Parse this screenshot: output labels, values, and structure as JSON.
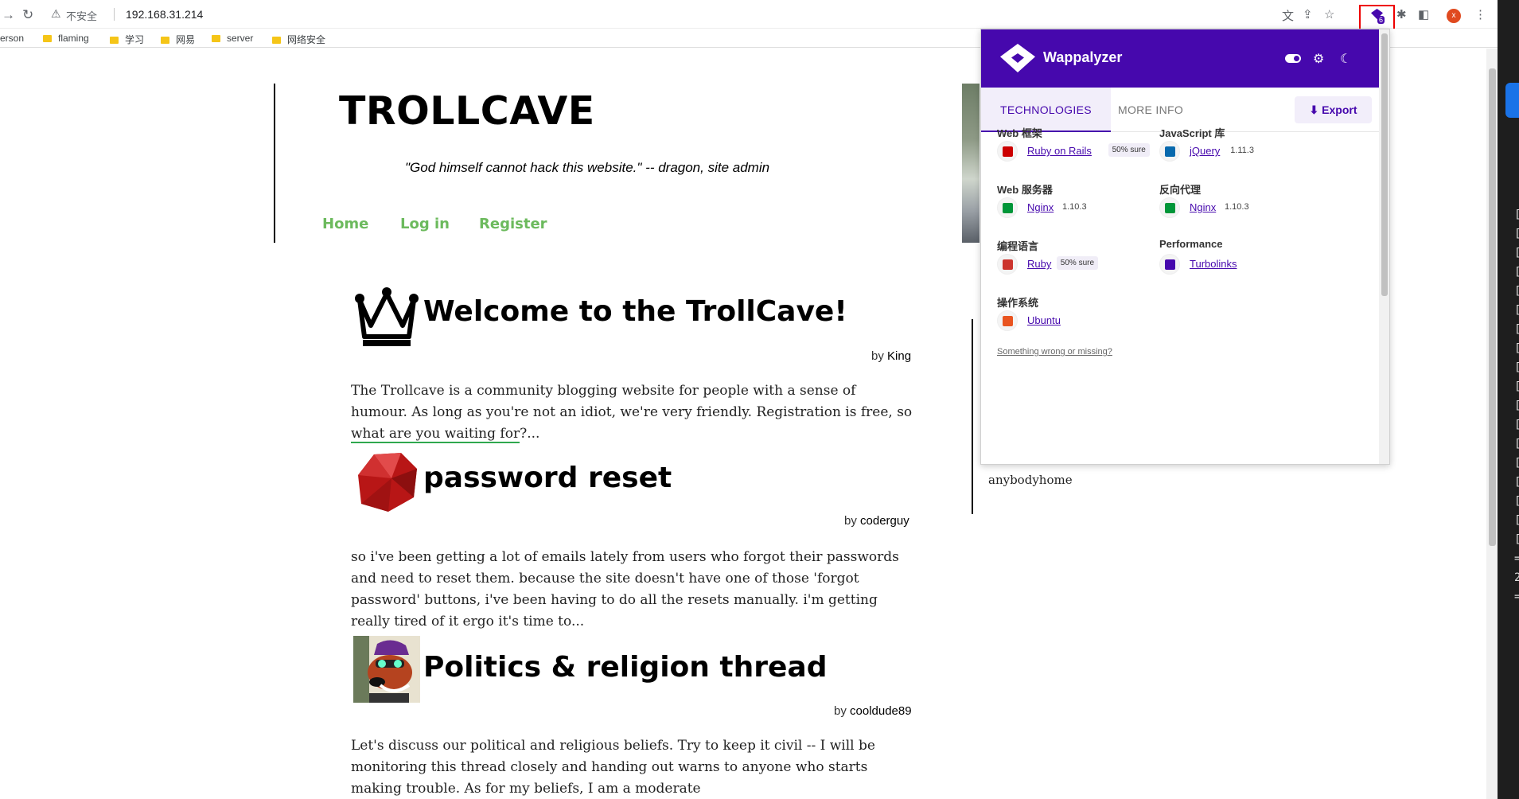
{
  "browser": {
    "back_icon": "arrow-right-icon",
    "url_warning": "不安全",
    "url": "192.168.31.214",
    "avatar_letter": "x",
    "extension_badge": "6"
  },
  "bookmarks": [
    {
      "label": "erson",
      "folder": false
    },
    {
      "label": "flaming",
      "folder": true
    },
    {
      "label": "学习",
      "folder": true
    },
    {
      "label": "网易",
      "folder": true
    },
    {
      "label": "server",
      "folder": true
    },
    {
      "label": "网络安全",
      "folder": true
    }
  ],
  "site": {
    "title": "TROLLCAVE",
    "tagline": "\"God himself cannot hack this website.\" -- dragon, site admin",
    "nav": [
      "Home",
      "Log in",
      "Register"
    ],
    "sidebar_text": "anybodyhome"
  },
  "posts": [
    {
      "title": "Welcome to the TrollCave!",
      "by": "by",
      "author": "King",
      "body_pre": "The Trollcave is a community blogging website for people with a sense of humour. As long as you're not an idiot, we're very friendly. Registration is free, so ",
      "body_link": "what are you waiting for",
      "body_post": "?...",
      "icon": "crown-icon"
    },
    {
      "title": "password reset",
      "by": "by",
      "author": "coderguy",
      "body": "so i've been getting a lot of emails lately from users who forgot their passwords and need to reset them. because the site doesn't have one of those 'forgot password' buttons, i've been having to do all the resets manually. i'm getting really tired of it ergo it's time to...",
      "icon": "ruby-gem-icon"
    },
    {
      "title": "Politics & religion thread",
      "by": "by",
      "author": "cooldude89",
      "body": "Let's discuss our political and religious beliefs. Try to keep it civil -- I will be monitoring this thread closely and handing out warns to anyone who starts making trouble. As for my beliefs, I am a moderate",
      "icon": "cartoon-dog-avatar"
    }
  ],
  "wappalyzer": {
    "brand": "Wappalyzer",
    "tabs": [
      "TECHNOLOGIES",
      "MORE INFO"
    ],
    "export": "Export",
    "categories": [
      {
        "name": "Web 框架",
        "tech": "Ruby on Rails",
        "version": "",
        "confidence": "50% sure",
        "color": "#cc0000"
      },
      {
        "name": "JavaScript 库",
        "tech": "jQuery",
        "version": "1.11.3",
        "confidence": "",
        "color": "#0769ad"
      },
      {
        "name": "Web 服务器",
        "tech": "Nginx",
        "version": "1.10.3",
        "confidence": "",
        "color": "#009639"
      },
      {
        "name": "反向代理",
        "tech": "Nginx",
        "version": "1.10.3",
        "confidence": "",
        "color": "#009639"
      },
      {
        "name": "编程语言",
        "tech": "Ruby",
        "version": "",
        "confidence": "50% sure",
        "color": "#cc342d"
      },
      {
        "name": "Performance",
        "tech": "Turbolinks",
        "version": "",
        "confidence": "",
        "color": "#4608ad"
      },
      {
        "name": "操作系统",
        "tech": "Ubuntu",
        "version": "",
        "confidence": "",
        "color": "#e95420"
      }
    ],
    "footer": "Something wrong or missing?"
  },
  "terminal": {
    "lines": [
      "[",
      "[",
      "[",
      "[",
      "[",
      "[",
      "[",
      "[",
      "[",
      "[",
      "[",
      "[",
      "[",
      "[",
      "[",
      "[",
      "[",
      "[",
      "=",
      "2",
      "="
    ]
  }
}
